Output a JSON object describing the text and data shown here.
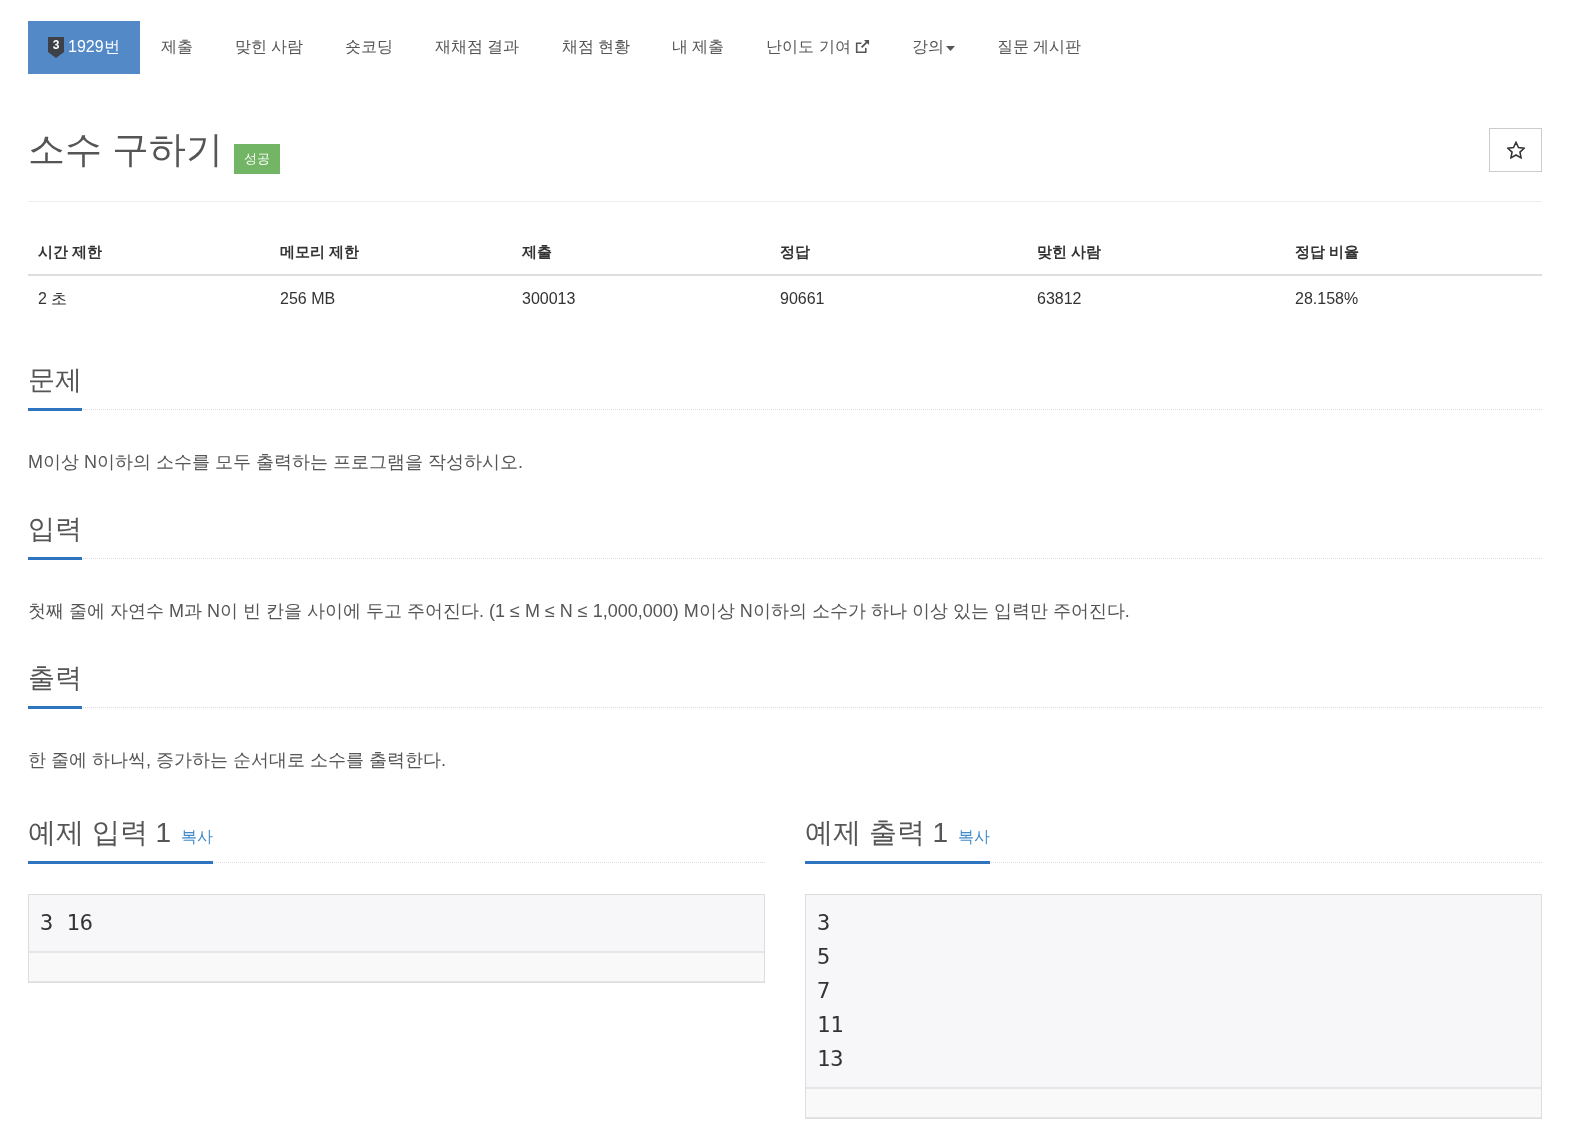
{
  "nav": {
    "tabs": [
      {
        "label": "1929번",
        "tier": "3",
        "kind": "problem",
        "selected": true
      },
      {
        "label": "제출",
        "kind": "plain",
        "selected": false
      },
      {
        "label": "맞힌 사람",
        "kind": "plain",
        "selected": false
      },
      {
        "label": "숏코딩",
        "kind": "plain",
        "selected": false
      },
      {
        "label": "재채점 결과",
        "kind": "plain",
        "selected": false
      },
      {
        "label": "채점 현황",
        "kind": "plain",
        "selected": false
      },
      {
        "label": "내 제출",
        "kind": "plain",
        "selected": false
      },
      {
        "label": "난이도 기여",
        "kind": "external",
        "selected": false
      },
      {
        "label": "강의",
        "kind": "dropdown",
        "selected": false
      },
      {
        "label": "질문 게시판",
        "kind": "plain",
        "selected": false
      }
    ]
  },
  "problem": {
    "title": "소수 구하기",
    "status_badge": "성공",
    "starred": false
  },
  "info_table": {
    "columns": [
      "시간 제한",
      "메모리 제한",
      "제출",
      "정답",
      "맞힌 사람",
      "정답 비율"
    ],
    "rows": [
      [
        "2 초",
        "256 MB",
        "300013",
        "90661",
        "63812",
        "28.158%"
      ]
    ]
  },
  "sections": [
    {
      "heading": "문제",
      "text": "M이상 N이하의 소수를 모두 출력하는 프로그램을 작성하시오."
    },
    {
      "heading": "입력",
      "text": "첫째 줄에 자연수 M과 N이 빈 칸을 사이에 두고 주어진다. (1 ≤ M ≤ N ≤ 1,000,000) M이상 N이하의 소수가 하나 이상 있는 입력만 주어진다."
    },
    {
      "heading": "출력",
      "text": "한 줄에 하나씩, 증가하는 순서대로 소수를 출력한다."
    }
  ],
  "samples": [
    {
      "heading": "예제 입력 1",
      "copy_link": "복사",
      "text": "3 16"
    },
    {
      "heading": "예제 출력 1",
      "copy_link": "복사",
      "text": "3\n5\n7\n11\n13"
    }
  ]
}
